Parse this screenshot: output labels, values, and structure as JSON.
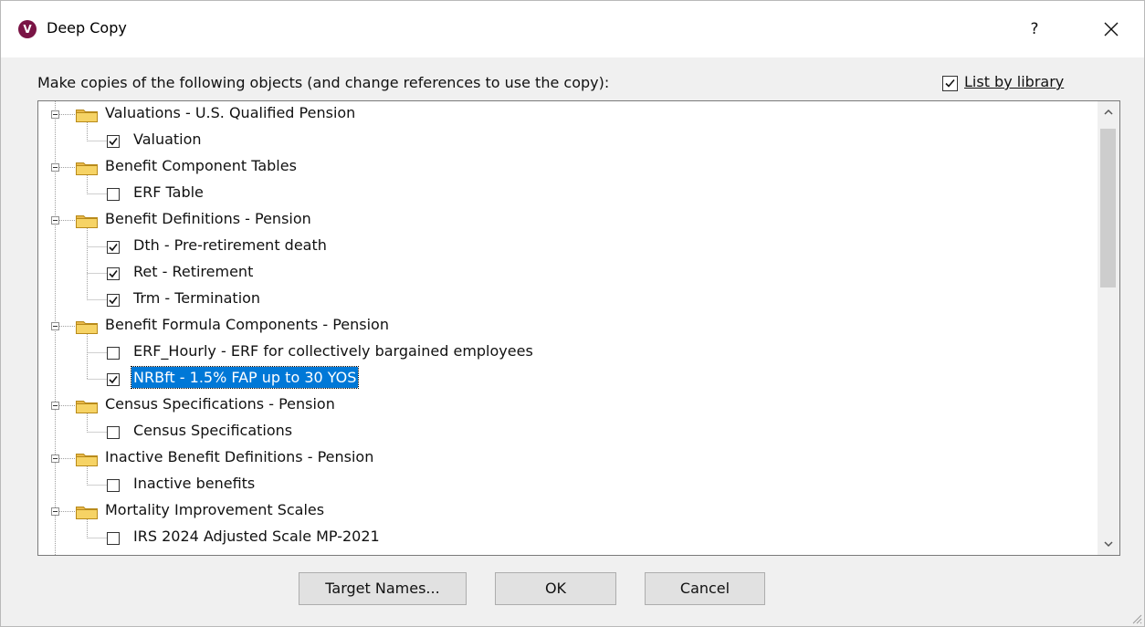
{
  "window": {
    "title": "Deep Copy",
    "help_label": "?",
    "app_icon_letter": "V"
  },
  "prompt": "Make copies of the following objects (and change references to use the copy):",
  "list_by_library": {
    "label": "List by library",
    "checked": true
  },
  "tree": {
    "groups": [
      {
        "label": "Valuations - U.S. Qualified Pension",
        "items": [
          {
            "label": "Valuation",
            "checked": true
          }
        ]
      },
      {
        "label": "Benefit Component Tables",
        "items": [
          {
            "label": "ERF Table",
            "checked": false
          }
        ]
      },
      {
        "label": "Benefit Definitions - Pension",
        "items": [
          {
            "label": "Dth - Pre-retirement death",
            "checked": true
          },
          {
            "label": "Ret - Retirement",
            "checked": true
          },
          {
            "label": "Trm - Termination",
            "checked": true
          }
        ]
      },
      {
        "label": "Benefit Formula Components - Pension",
        "items": [
          {
            "label": "ERF_Hourly - ERF for collectively bargained employees",
            "checked": false
          },
          {
            "label": "NRBft - 1.5% FAP up to 30 YOS",
            "checked": true,
            "selected": true
          }
        ]
      },
      {
        "label": "Census Specifications - Pension",
        "items": [
          {
            "label": "Census Specifications",
            "checked": false
          }
        ]
      },
      {
        "label": "Inactive Benefit Definitions - Pension",
        "items": [
          {
            "label": "Inactive benefits",
            "checked": false
          }
        ]
      },
      {
        "label": "Mortality Improvement Scales",
        "items": [
          {
            "label": "IRS 2024 Adjusted Scale MP-2021",
            "checked": false
          }
        ]
      }
    ]
  },
  "buttons": {
    "target_names": "Target Names...",
    "ok": "OK",
    "cancel": "Cancel"
  },
  "colors": {
    "selection": "#0078d7",
    "app_icon": "#7a1445",
    "folder": "#f6d365"
  }
}
